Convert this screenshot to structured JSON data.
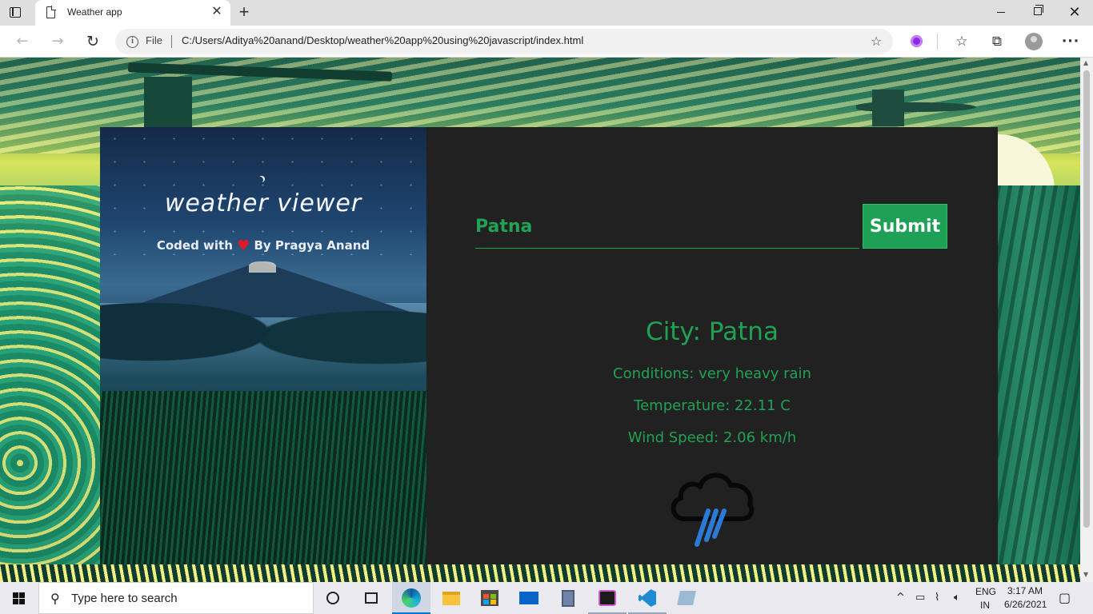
{
  "browser": {
    "tab_title": "Weather app",
    "tab_close": "✕",
    "new_tab": "+",
    "file_label": "File",
    "url": "C:/Users/Aditya%20anand/Desktop/weather%20app%20using%20javascript/index.html"
  },
  "app": {
    "title": "weather viewer",
    "credit_prefix": "Coded with",
    "credit_suffix": "By Pragya Anand",
    "search": {
      "value": "Patna"
    },
    "submit_label": "Submit",
    "city_line": "City: Patna",
    "conditions_line": "Conditions: very heavy rain",
    "temperature_line": "Temperature: 22.11 C",
    "wind_line": "Wind Speed: 2.06 km/h",
    "weather_icon": "heavy-rain-cloud-icon"
  },
  "taskbar": {
    "search_placeholder": "Type here to search",
    "lang_top": "ENG",
    "lang_bottom": "IN",
    "time": "3:17 AM",
    "date": "6/26/2021"
  },
  "colors": {
    "accent_green": "#20a254",
    "panel_dark": "#212121",
    "heart_red": "#e3182b"
  }
}
